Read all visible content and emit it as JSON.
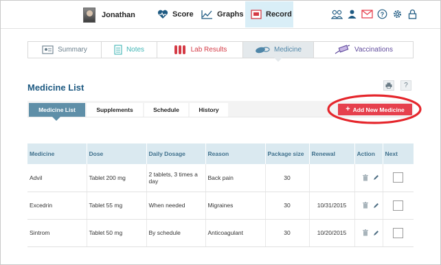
{
  "header": {
    "user_name": "Jonathan",
    "nav": [
      {
        "label": "Score",
        "icon": "heart-icon"
      },
      {
        "label": "Graphs",
        "icon": "line-graph-icon"
      },
      {
        "label": "Record",
        "icon": "record-icon"
      }
    ],
    "active_nav": "Record",
    "top_icons": [
      "people-icon",
      "person-icon",
      "mail-icon",
      "help-icon",
      "gear-icon",
      "lock-icon"
    ]
  },
  "subtabs": [
    {
      "label": "Summary",
      "icon": "summary-icon",
      "color": "#6a7f8c"
    },
    {
      "label": "Notes",
      "icon": "notes-icon",
      "color": "#3fb5b5"
    },
    {
      "label": "Lab Results",
      "icon": "test-tubes-icon",
      "color": "#d43a45"
    },
    {
      "label": "Medicine",
      "icon": "pills-icon",
      "color": "#4f86a8"
    },
    {
      "label": "Vaccinations",
      "icon": "syringe-icon",
      "color": "#5f4a9c"
    }
  ],
  "active_subtab": "Medicine",
  "page_title": "Medicine List",
  "list_tabs": [
    "Medicine List",
    "Supplements",
    "Schedule",
    "History"
  ],
  "active_list_tab": "Medicine List",
  "add_button_label": "Add New Medicine",
  "table": {
    "columns": [
      "Medicine",
      "Dose",
      "Daily Dosage",
      "Reason",
      "Package size",
      "Renewal",
      "Action",
      "Next"
    ],
    "rows": [
      {
        "medicine": "Advil",
        "dose": "Tablet 200 mg",
        "daily": "2 tablets, 3 times a day",
        "reason": "Back pain",
        "package": "30",
        "renewal": "",
        "next_checked": false
      },
      {
        "medicine": "Excedrin",
        "dose": "Tablet 55 mg",
        "daily": "When needed",
        "reason": "Migraines",
        "package": "30",
        "renewal": "10/31/2015",
        "next_checked": false
      },
      {
        "medicine": "Sintrom",
        "dose": "Tablet 50 mg",
        "daily": "By schedule",
        "reason": "Anticoagulant",
        "package": "30",
        "renewal": "10/20/2015",
        "next_checked": false
      }
    ]
  },
  "colors": {
    "title": "#1e5a82",
    "accent": "#5f8fa8",
    "add_button": "#e6404d",
    "highlight_ellipse": "#e5262c",
    "table_header": "#dae9f0",
    "active_nav": "#d9eef7"
  }
}
